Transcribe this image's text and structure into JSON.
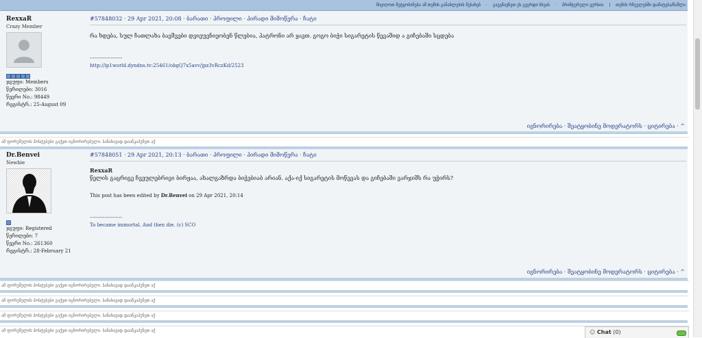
{
  "topbar": {
    "links": [
      "მიეიღოთ შეტყობინება ამ თემის განახლების შესახებ",
      "გაუგზავნეთ ეს გვერდი სხვას",
      "პრინტერული ვერსია",
      "თემის რჩეულებში დამატება/წაშლა"
    ],
    "separators": [
      "·",
      "·",
      "·",
      "|"
    ]
  },
  "posts": [
    {
      "author": "RexxaR",
      "rank": "Crazy Member",
      "pips": 5,
      "group": "ჯგუფი: Members",
      "posts": "წერილები: 3016",
      "number": "წევრი No.: 98449",
      "registered": "რეგისტრ.: 25-August 09",
      "post_id": "#57848032",
      "date": " · 29 Apr 2021, 20:08 · ",
      "head_links": "ბარათი · პროფილი · პირადი მიმოწერა · ჩატი",
      "text": "რა ხდება, სულ ჩათლახა ბავშვები დვიეუვნიეობენ წლებია, პატრონი არ ყავთ. გოგო ბიჭი სიგარეტის წევაშიდ ა გიჩებაში სცდება",
      "signature_dashes": "--------------------",
      "signature": "http://ip1world.dyndns.tv:25461/obgQ7x5avv/jpz3vRczKd/2523",
      "actions": "იგნორირება · შეატყობინე მოდერატორს  · ციტირება · ^"
    },
    {
      "author": "Dr.Benvei",
      "rank": "Newbie",
      "pips": 1,
      "group": "ჯგუფი: Registered",
      "posts": "წერილები: 7",
      "number": "წევრი No.: 261360",
      "registered": "რეგისტრ.: 28-February 21",
      "post_id": "#57848051",
      "date": " · 29 Apr 2021, 20:13 · ",
      "head_links": "ბარათი · პროფილი · პირადი მიმოწერა · ჩატი",
      "quote_name": "RexxaR",
      "text": "წელის გაცრიგე ჩვეულებრივი ბირჟაა, ახალგაზრდა ბიჭებიაბ არიან. აქა-იქ სიგარეტის მოწევას და გიჩებაში ვარჯიშს რა უჭირს?",
      "edit_prefix": "This post has been edited by ",
      "edit_by": "Dr.Benvei",
      "edit_suffix": " on 29 Apr 2021, 20:14",
      "signature_dashes": "--------------------",
      "signature": "To became immortal. And then die. (c) SCO",
      "actions": "იგნორირება · შეატყობინე მოდერატორს  · ციტირება · ^"
    }
  ],
  "ignored_text": "ამ ფორუმელის პოსტებები გაქვთ იგნორირებული. სანახავად დააწკაპუნეთ აქ",
  "chat": {
    "label": "Chat",
    "count": "(0)"
  }
}
